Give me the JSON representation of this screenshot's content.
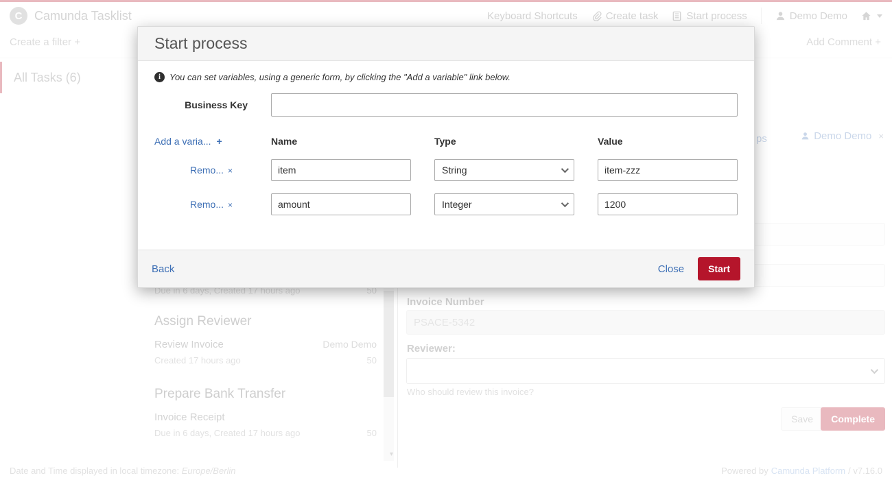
{
  "colors": {
    "accent_red": "#b5152b",
    "link_blue": "#3d6fb5",
    "footer_link_blue": "#7ba2d6"
  },
  "header": {
    "brand": "Camunda Tasklist",
    "logo_glyph": "C",
    "keyboard_shortcuts": "Keyboard Shortcuts",
    "create_task": "Create task",
    "start_process": "Start process",
    "user": "Demo Demo"
  },
  "toolbar": {
    "create_filter": "Create a filter",
    "create_filter_plus": "+",
    "add_comment": "Add Comment",
    "add_comment_plus": "+"
  },
  "filters": {
    "all_tasks": "All Tasks (6)"
  },
  "task_list": {
    "items": [
      {
        "meta": "Due in 6 days, Created 17 hours ago",
        "priority": "50"
      },
      {
        "title": "Assign Reviewer",
        "subtitle": "Review Invoice",
        "assignee": "Demo Demo",
        "meta": "Created 17 hours ago",
        "priority": "50"
      },
      {
        "title": "Prepare Bank Transfer",
        "subtitle": "Invoice Receipt",
        "meta": "Due in 6 days, Created 17 hours ago",
        "priority": "50"
      }
    ],
    "scroll_arrow": "▾"
  },
  "task_detail": {
    "partial_link_text": "ps",
    "assignee": "Demo Demo",
    "assignee_remove": "×",
    "invoice_number_label": "Invoice Number",
    "invoice_number_value": "PSACE-5342",
    "reviewer_label": "Reviewer:",
    "reviewer_help": "Who should review this invoice?",
    "save": "Save",
    "complete": "Complete"
  },
  "modal": {
    "title": "Start process",
    "info_icon_glyph": "i",
    "info": "You can set variables, using a generic form, by clicking the \"Add a variable\" link below.",
    "business_key_label": "Business Key",
    "business_key_value": "",
    "add_variable": "Add a varia...",
    "add_variable_plus": "+",
    "col_name": "Name",
    "col_type": "Type",
    "col_value": "Value",
    "variables": [
      {
        "remove": "Remo...",
        "remove_x": "×",
        "name": "item",
        "type": "String",
        "value": "item-zzz"
      },
      {
        "remove": "Remo...",
        "remove_x": "×",
        "name": "amount",
        "type": "Integer",
        "value": "1200"
      }
    ],
    "back": "Back",
    "close": "Close",
    "start": "Start"
  },
  "footer": {
    "timezone_text": "Date and Time displayed in local timezone:",
    "timezone_value": "Europe/Berlin",
    "powered_by": "Powered by",
    "platform_link": "Camunda Platform",
    "version": "/ v7.16.0"
  }
}
